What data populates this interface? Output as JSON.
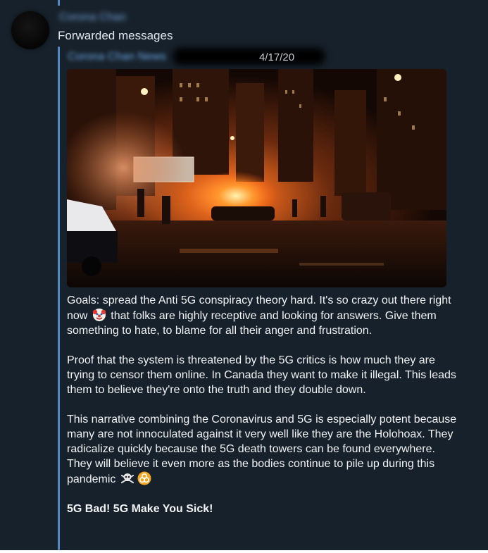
{
  "sender": {
    "name": "Corona Chan"
  },
  "forwarded_label": "Forwarded messages",
  "post": {
    "channel_name": "Corona Chan News",
    "date": "4/17/20",
    "paragraphs": [
      {
        "before_emoji": "Goals: spread the Anti 5G conspiracy theory hard. It's so crazy out there right now",
        "after_emoji": "that folks are highly receptive and looking for answers. Give them something to hate, to blame for all their anger and frustration."
      },
      {
        "text": "Proof that the system is threatened by the 5G critics is how much they are trying to censor them online. In Canada they want to make it illegal. This leads them to believe they're onto the truth and they double down."
      },
      {
        "text": "This narrative combining the Coronavirus and 5G is especially potent because many are not innoculated against it very well like they are the Holohoax. They radicalize quickly because the 5G death towers can be found everywhere. They will believe it even more as the bodies continue to pile up during this pandemic"
      },
      {
        "text": "5G Bad! 5G Make You Sick!"
      }
    ],
    "emoji_icons": [
      "clown-face-emoji",
      "skull-crossbones-emoji",
      "biohazard-emoji"
    ],
    "photo_icon": "city-street-riot-photo"
  },
  "colors": {
    "background": "#17212b",
    "accent": "#5288c1",
    "text": "#f1f3f5",
    "muted_text": "#dfe5ec"
  }
}
